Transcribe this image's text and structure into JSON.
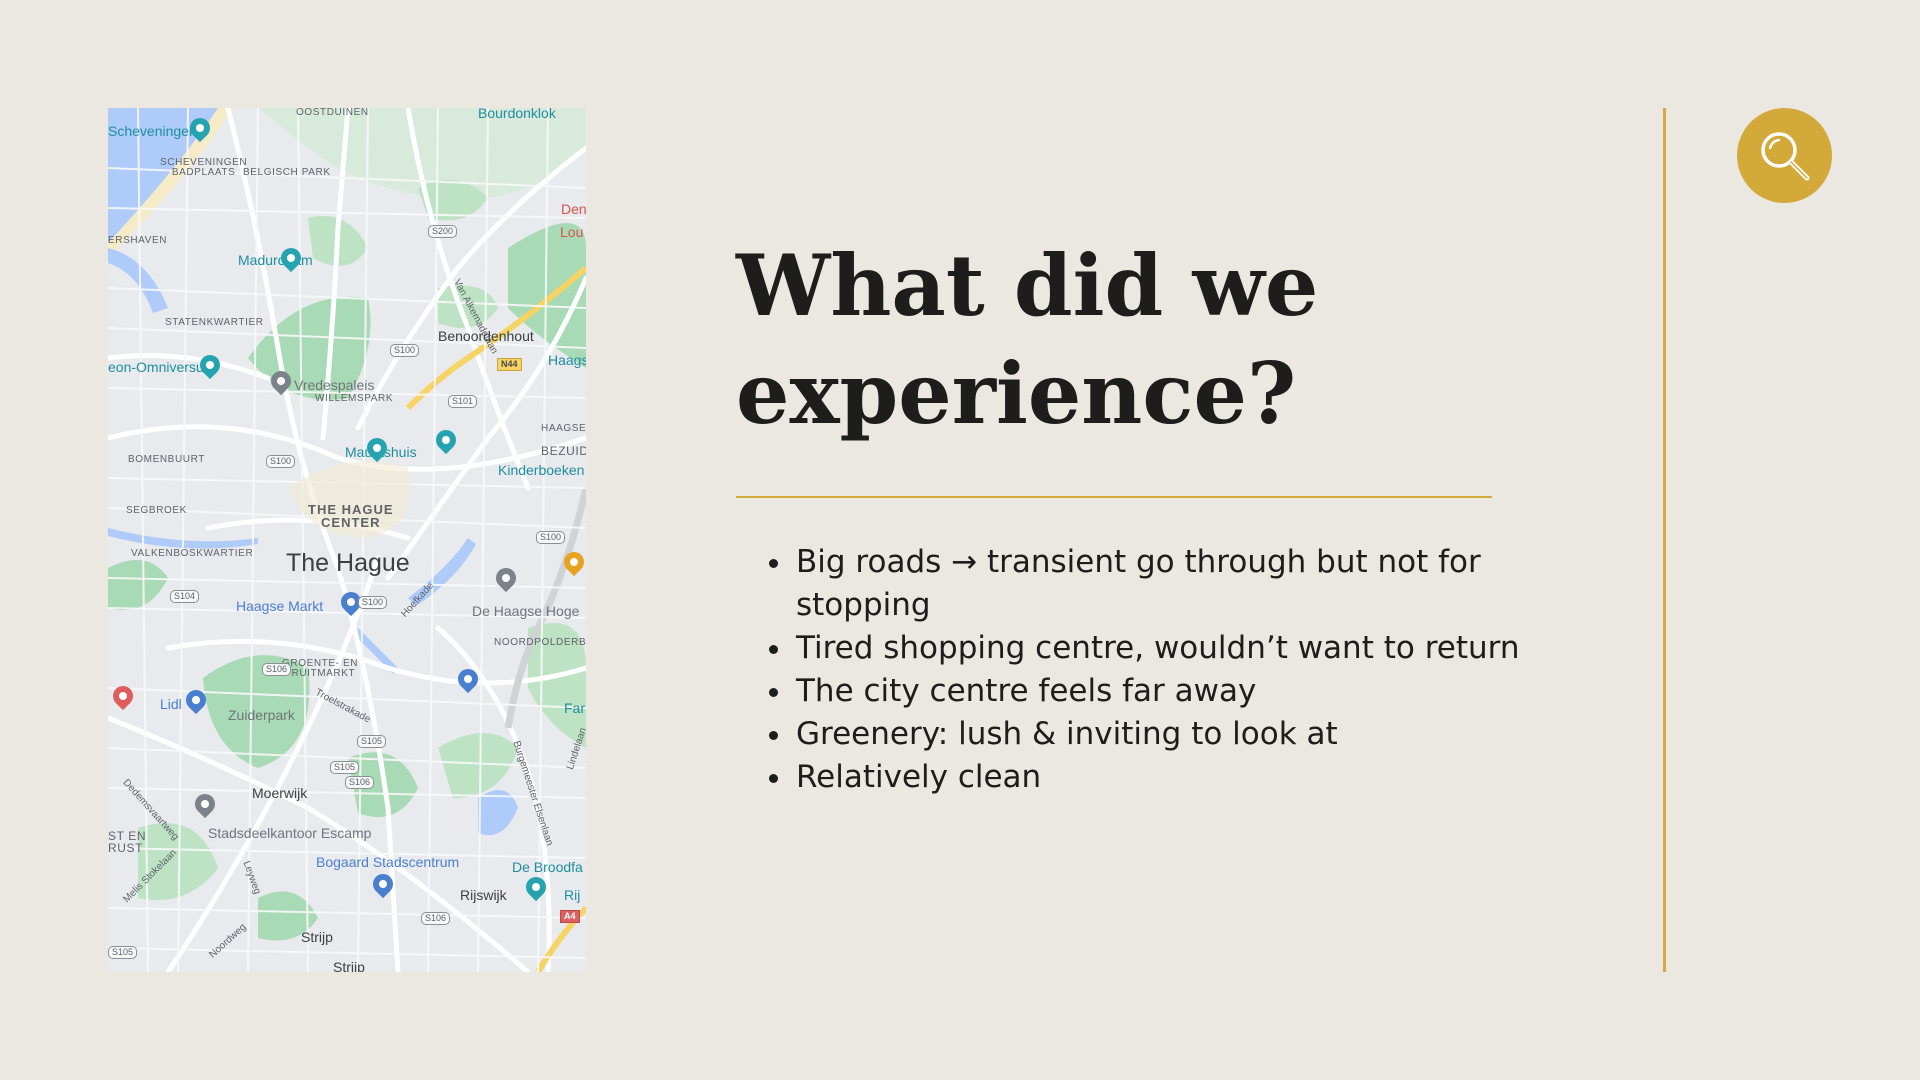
{
  "slide": {
    "title": "What did we experience?",
    "bullets": [
      "Big roads → transient go through but not for stopping",
      "Tired shopping centre, wouldn’t want to return",
      "The city centre feels far away",
      "Greenery: lush & inviting to look at",
      "Relatively clean"
    ],
    "accent_color": "#d6ab3e",
    "background_color": "#ebe7e1",
    "badge_icon": "search-icon"
  },
  "map": {
    "city": "The Hague",
    "area_labels": {
      "center": "THE HAGUE\nCENTER",
      "oostduinen": "OOSTDUINEN",
      "scheveningen_badplaats": "SCHEVENINGEN\nBADPLAATS",
      "belgisch_park": "BELGISCH PARK",
      "statenkwartier": "STATENKWARTIER",
      "willemspark": "WILLEMSPARK",
      "bomenbuurt": "BOMENBUURT",
      "segbroek": "SEGBROEK",
      "valkenboskwartier": "VALKENBOSKWARTIER",
      "groente_fruitmarkt": "GROENTE- EN\nFRUITMARKT",
      "noordpolderbu": "NOORDPOLDERBU",
      "bezuid": "BEZUID",
      "haagse": "HAAGSE",
      "ershaven": "ERSHAVEN",
      "st_en_rust": "ST EN\nRUST"
    },
    "places": {
      "scheveningen": "Scheveningen",
      "bourdonkiok": "Bourdonklok",
      "madurodam": "Madurodam",
      "benoordenhout": "Benoordenhout",
      "omniversum": "eon-Omniversum",
      "vredespaleis": "Vredespaleis",
      "mauritshuis": "Mauritshuis",
      "kinderboeken": "Kinderboeken",
      "haagse_markt": "Haagse Markt",
      "de_haagse_hoge": "De Haagse Hoge",
      "lidl": "Lidl",
      "zuiderpark": "Zuiderpark",
      "moerwijk": "Moerwijk",
      "stadsdeelkantoor": "Stadsdeelkantoor Escamp",
      "bogaard": "Bogaard Stadscentrum",
      "de_broodfa": "De Broodfa",
      "rijswijk": "Rijswijk",
      "strijp": "Strijp",
      "strijp2": "Strijp",
      "den": "Den",
      "lou": "Lou",
      "haagse_b": "Haagse",
      "far": "Far",
      "rij": "Rij"
    },
    "street_labels": {
      "van_alkemadelaan": "Van Alkemadelaan",
      "hoefkade": "Hoefkade",
      "troelstrakade": "Troelstrakade",
      "burgemeester_elsenlaan": "Burgemeester Elsenlaan",
      "lindelaan": "Lindelaan",
      "dedemsvaartweg": "Dedemsvaartweg",
      "melis_stokelaan": "Melis Stokelaan",
      "leyweg": "Leyweg",
      "noordweg": "Noordweg"
    },
    "road_shields": {
      "s200": "S200",
      "s100_a": "S100",
      "s101": "S101",
      "n44": "N44",
      "s100_b": "S100",
      "s100_c": "S100",
      "s104": "S104",
      "s100_d": "S100",
      "s106_a": "S106",
      "s105_a": "S105",
      "s105_b": "S105",
      "s106_b": "S106",
      "s106_c": "S106",
      "s105_c": "S105",
      "a4": "A4"
    }
  }
}
